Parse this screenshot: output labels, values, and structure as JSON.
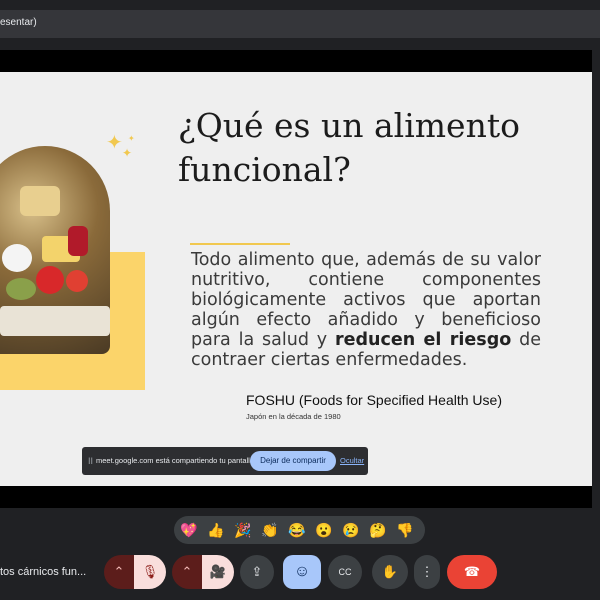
{
  "browser": {
    "tab_title": "esentar)"
  },
  "slide": {
    "title_line1": "¿Qué es un alimento",
    "title_line2": "funcional?",
    "body_before": "Todo alimento que, además de su valor nutritivo, contiene componentes biológicamente activos que aportan algún efecto añadido y beneficioso para la salud y ",
    "body_bold": "reducen el riesgo",
    "body_after": " de contraer ciertas enfermedades.",
    "foshu": "FOSHU (Foods for Specified Health Use)",
    "foshu_sub": "Japón en la década de 1980"
  },
  "share_bar": {
    "handle": "II",
    "message": "meet.google.com está compartiendo tu pantalla.",
    "stop_label": "Dejar de compartir",
    "hide_label": "Ocultar"
  },
  "reactions": [
    "💖",
    "👍",
    "🎉",
    "👏",
    "😂",
    "😮",
    "😢",
    "🤔",
    "👎"
  ],
  "meeting": {
    "name": "tos cárnicos fun..."
  },
  "controls": {
    "chevron": "⌃",
    "mic_icon": "🎙",
    "cam_icon": "🎥",
    "present_icon": "⇪",
    "emoji_icon": "☺",
    "captions_icon": "CC",
    "hand_icon": "✋",
    "more_icon": "⋮",
    "hangup_icon": "☎"
  },
  "colors": {
    "accent_yellow": "#fbd46a",
    "muted_red": "#f9dedc",
    "hangup_red": "#ea4335",
    "highlight_blue": "#a8c7fa"
  }
}
